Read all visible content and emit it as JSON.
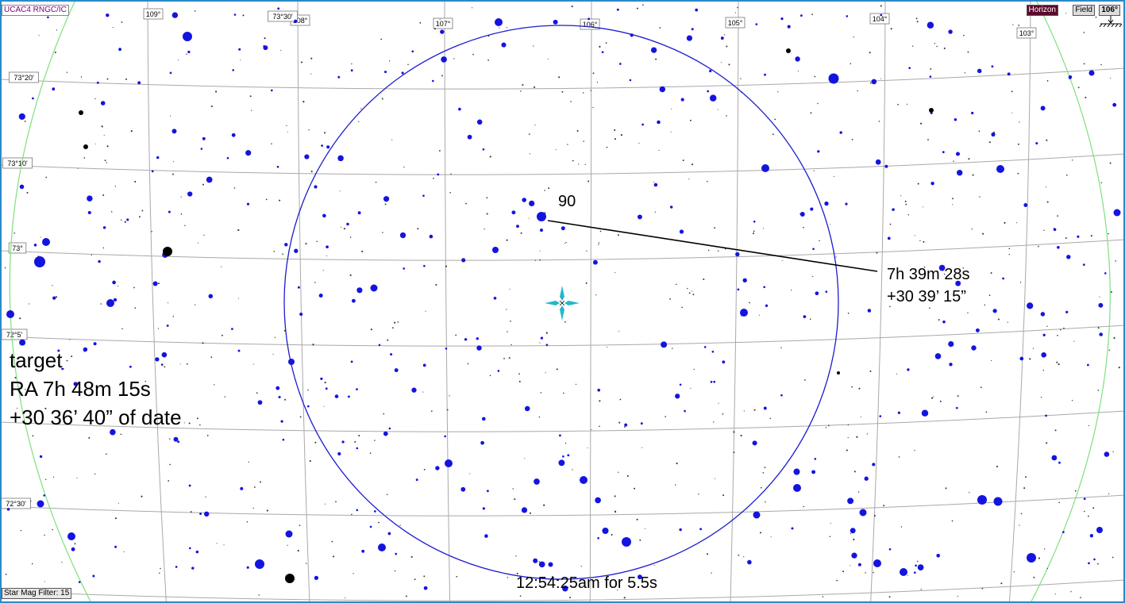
{
  "toolbar": {
    "catalog_tag": "UCAC4 RNGC/IC",
    "horizon_button": "Horizon",
    "field_button": "Field",
    "azimuth_readout": "106°",
    "star_mag_filter": "Star Mag Filter: 15"
  },
  "grid_labels": {
    "azimuth": [
      "109°",
      "108°",
      "107°",
      "106°",
      "105°",
      "104°",
      "103°"
    ],
    "altitude": [
      "73°30'",
      "73°20'",
      "73°10'",
      "73°",
      "72°5'",
      "72°30'"
    ]
  },
  "annotations": {
    "target_lines": [
      "target",
      "RA 7h 48m 15s",
      "+30 36’ 40” of date"
    ],
    "star_label": "90",
    "star_ra": "7h 39m 28s",
    "star_dec": "+30 39’ 15”",
    "exposure": "12:54:25am for 5.5s"
  },
  "colors": {
    "star": "#1414e0",
    "grid": "#a9a9a9",
    "fov_circle": "#1c1cd0",
    "crosshair": "#22b8c8",
    "horizon_arc": "#7ee07e",
    "window_border": "#2a8ac8",
    "bright_star": "#000000"
  }
}
